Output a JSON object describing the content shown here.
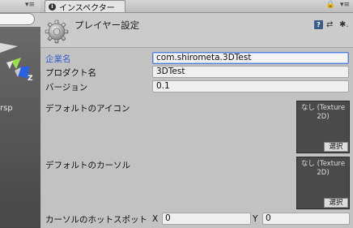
{
  "scene_panel": {
    "menu_glyph": "▾≡",
    "view_mode_label": "rsp",
    "gizmo_axis_label": "Z"
  },
  "inspector": {
    "tab_label": "インスペクター",
    "tab_icon": "info-icon",
    "tab_controls": {
      "lock": "🔒",
      "menu": "▾≡"
    },
    "header": {
      "title": "プレイヤー設定",
      "help_glyph": "?",
      "presets_glyph": "⇄",
      "settings_glyph": "✱."
    },
    "fields": [
      {
        "label": "企業名",
        "value": "com.shirometa.3DTest"
      },
      {
        "label": "プロダクト名",
        "value": "3DTest"
      },
      {
        "label": "バージョン",
        "value": "0.1"
      }
    ],
    "default_icon": {
      "label": "デフォルトのアイコン",
      "slot_text": "なし (Texture 2D)",
      "select_label": "選択"
    },
    "default_cursor": {
      "label": "デフォルトのカーソル",
      "slot_text": "なし (Texture 2D)",
      "select_label": "選択"
    },
    "cursor_hotspot": {
      "label": "カーソルのホットスポット",
      "x_label": "X",
      "x_value": "0",
      "y_label": "Y",
      "y_value": "0"
    }
  },
  "colors": {
    "panel_bg": "#c2c2c2",
    "active_label": "#3a5fc8",
    "focus_border": "#5680d8"
  }
}
